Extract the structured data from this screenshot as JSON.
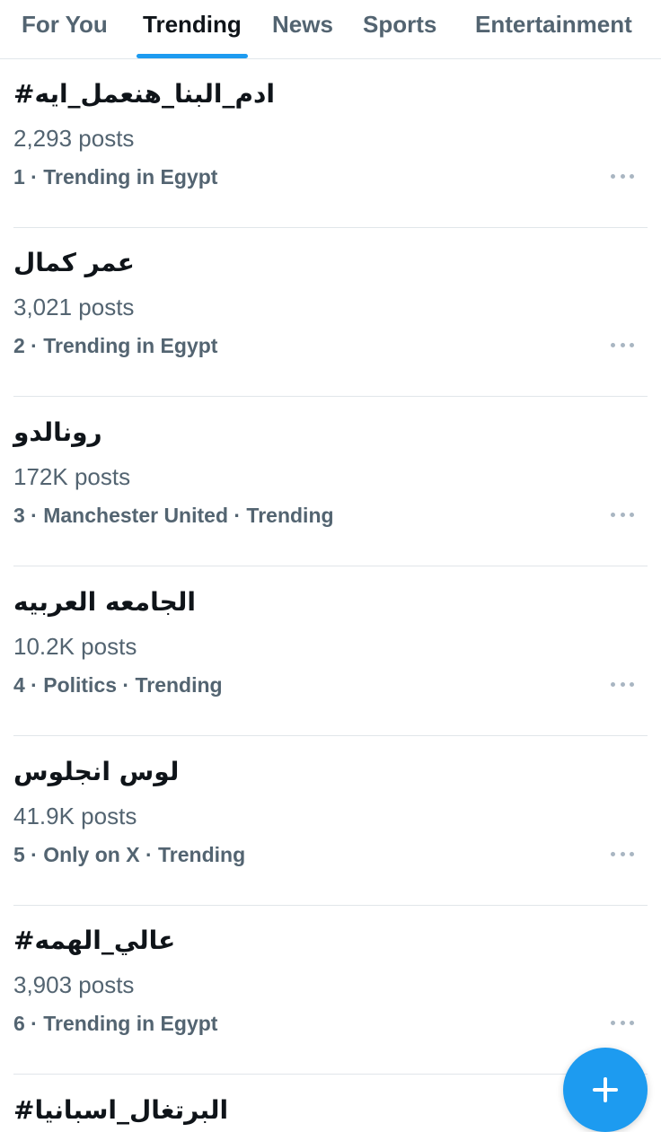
{
  "tabs": [
    {
      "label": "For You"
    },
    {
      "label": "Trending"
    },
    {
      "label": "News"
    },
    {
      "label": "Sports"
    },
    {
      "label": "Entertainment"
    }
  ],
  "active_tab": "Trending",
  "accent_color": "#1d9bf0",
  "trends": [
    {
      "title": "#ادم_البنا_هنعمل_ايه",
      "posts": "2,293 posts",
      "meta": "1 · Trending in Egypt"
    },
    {
      "title": "عمر كمال",
      "posts": "3,021 posts",
      "meta": "2 · Trending in Egypt"
    },
    {
      "title": "رونالدو",
      "posts": "172K posts",
      "meta": "3 · Manchester United · Trending"
    },
    {
      "title": "الجامعه العربيه",
      "posts": "10.2K posts",
      "meta": "4 · Politics · Trending"
    },
    {
      "title": "لوس انجلوس",
      "posts": "41.9K posts",
      "meta": "5 · Only on X · Trending"
    },
    {
      "title": "#عالي_الهمه",
      "posts": "3,903 posts",
      "meta": "6 · Trending in Egypt"
    },
    {
      "title": "#البرتغال_اسبانيا"
    }
  ],
  "icons": {
    "more": "more-horizontal-icon",
    "compose": "plus-icon"
  }
}
